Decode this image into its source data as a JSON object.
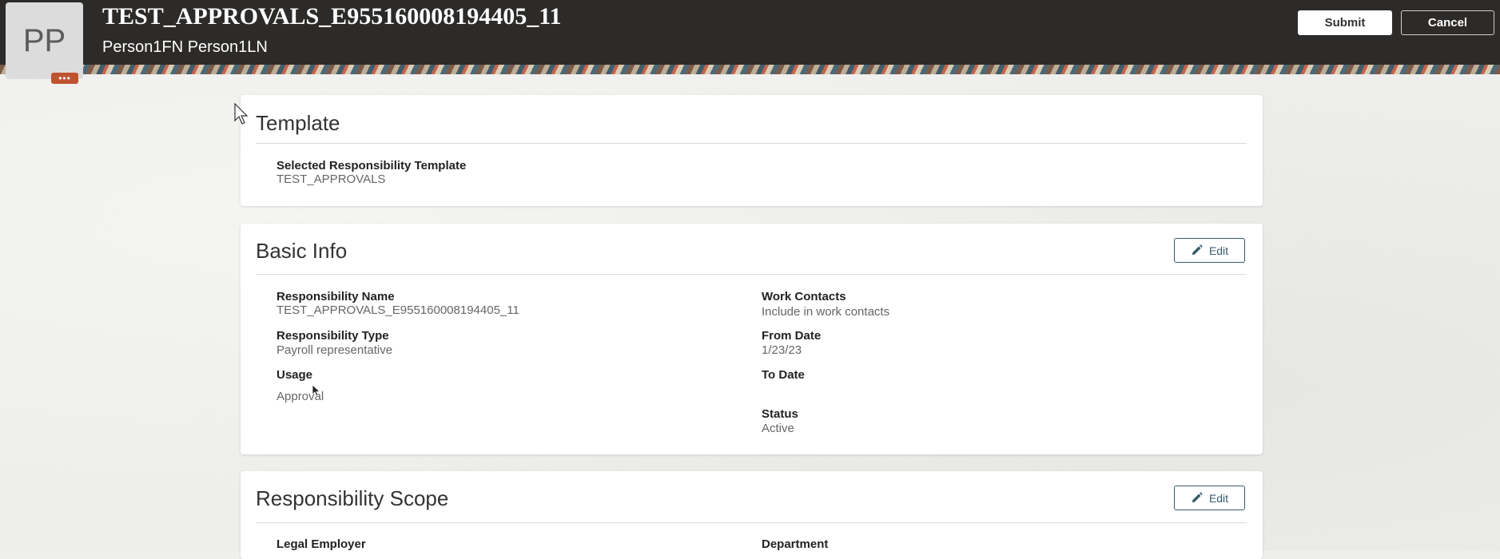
{
  "header": {
    "avatar_initials": "PP",
    "more_label": "•••",
    "title": "TEST_APPROVALS_E955160008194405_11",
    "subtitle": "Person1FN Person1LN",
    "submit_label": "Submit",
    "cancel_label": "Cancel"
  },
  "template_section": {
    "title": "Template",
    "fields": [
      {
        "label": "Selected Responsibility Template",
        "value": "TEST_APPROVALS"
      }
    ]
  },
  "basic_info": {
    "title": "Basic Info",
    "edit_label": "Edit",
    "left_fields": [
      {
        "label": "Responsibility Name",
        "value": "TEST_APPROVALS_E955160008194405_11"
      },
      {
        "label": "Responsibility Type",
        "value": "Payroll representative"
      },
      {
        "label": "Usage",
        "value": "Approval"
      }
    ],
    "right_fields": [
      {
        "label": "Work Contacts",
        "value": "Include in work contacts"
      },
      {
        "label": "From Date",
        "value": "1/23/23"
      },
      {
        "label": "To Date",
        "value": ""
      },
      {
        "label": "Status",
        "value": "Active"
      }
    ]
  },
  "scope": {
    "title": "Responsibility Scope",
    "edit_label": "Edit",
    "left_fields": [
      {
        "label": "Legal Employer"
      }
    ],
    "right_fields": [
      {
        "label": "Department"
      }
    ]
  },
  "colors": {
    "header_bg": "#2d2b29",
    "accent": "#c0522f",
    "edit_border": "#355b6c"
  }
}
